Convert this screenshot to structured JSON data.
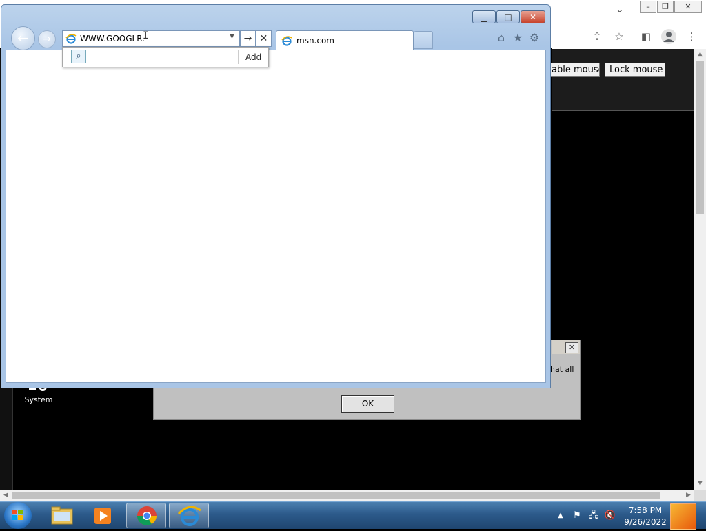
{
  "background_browser": {
    "window_controls": [
      "–",
      "❐",
      "✕"
    ],
    "tab_chevron": "⌄",
    "toolbar_icons": [
      "share-icon",
      "star-icon",
      "sidepanel-icon",
      "profile-icon",
      "menu-icon"
    ],
    "page_buttons": {
      "enable_mouse": "able mouse",
      "lock_mouse": "Lock mouse"
    }
  },
  "desktop": {
    "icon_label": "System"
  },
  "dialog": {
    "text_fragment": "hat all",
    "ok_label": "OK"
  },
  "ie": {
    "address_text": "WWW.GOOGLR.",
    "tab_label": "msn.com",
    "go_symbol": "→",
    "stop_symbol": "✕",
    "suggest_add_label": "Add",
    "window_buttons": {
      "minimize": "▁",
      "maximize": "□",
      "close": "✕"
    }
  },
  "taskbar": {
    "time": "7:58 PM",
    "date": "9/26/2022",
    "pinned": [
      "explorer",
      "media-player",
      "chrome",
      "internet-explorer"
    ]
  }
}
